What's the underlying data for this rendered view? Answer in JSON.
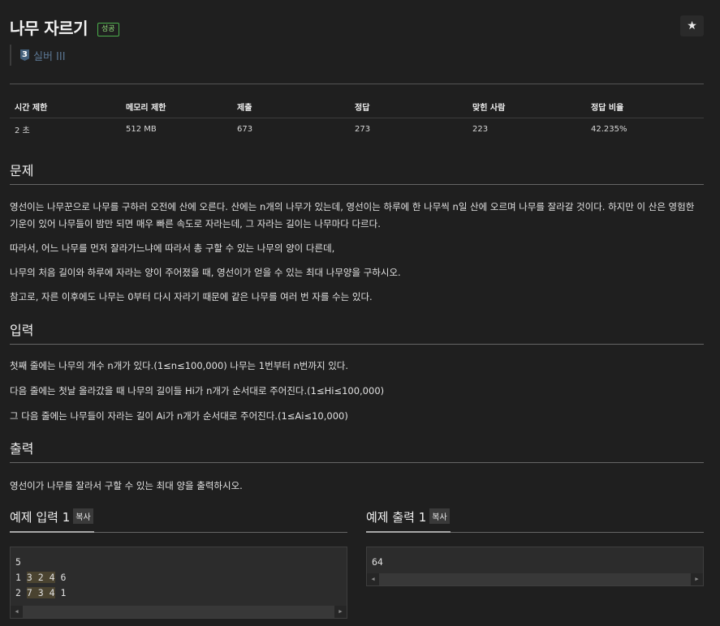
{
  "problem": {
    "title": "나무 자르기",
    "status_badge": "성공",
    "star_glyph": "★",
    "tier_number": "3",
    "tier_label": "실버 III"
  },
  "stats": {
    "headers": [
      "시간 제한",
      "메모리 제한",
      "제출",
      "정답",
      "맞힌 사람",
      "정답 비율"
    ],
    "values": [
      "2 초",
      "512 MB",
      "673",
      "273",
      "223",
      "42.235%"
    ]
  },
  "sections": {
    "problem_heading": "문제",
    "problem_paragraphs": [
      "영선이는 나무꾼으로 나무를 구하러 오전에 산에 오른다. 산에는 n개의 나무가 있는데, 영선이는 하루에 한 나무씩 n일 산에 오르며 나무를 잘라갈 것이다. 하지만 이 산은 영험한 기운이 있어 나무들이 밤만 되면 매우 빠른 속도로 자라는데, 그 자라는 길이는 나무마다 다르다.",
      "따라서, 어느 나무를 먼저 잘라가느냐에 따라서 총 구할 수 있는 나무의 양이 다른데,",
      "나무의 처음 길이와 하루에 자라는 양이 주어졌을 때, 영선이가 얻을 수 있는 최대 나무양을 구하시오.",
      "참고로, 자른 이후에도 나무는 0부터 다시 자라기 때문에 같은 나무를 여러 번 자를 수는 있다."
    ],
    "input_heading": "입력",
    "input_paragraphs": [
      "첫째 줄에는 나무의 개수 n개가 있다.(1≤n≤100,000) 나무는 1번부터 n번까지 있다.",
      "다음 줄에는 첫날 올라갔을 때 나무의 길이들 Hi가 n개가 순서대로 주어진다.(1≤Hi≤100,000)",
      "그 다음 줄에는 나무들이 자라는 길이 Ai가 n개가 순서대로 주어진다.(1≤Ai≤10,000)"
    ],
    "output_heading": "출력",
    "output_paragraphs": [
      "영선이가 나무를 잘라서 구할 수 있는 최대 양을 출력하시오."
    ]
  },
  "samples": {
    "input_title": "예제 입력 1",
    "output_title": "예제 출력 1",
    "copy_label": "복사",
    "input_lines": [
      [
        "5"
      ],
      [
        "1",
        "3",
        "2",
        "4",
        "6"
      ],
      [
        "2",
        "7",
        "3",
        "4",
        "1"
      ]
    ],
    "output_text": "64",
    "scroll_left": "◀",
    "scroll_right": "▶"
  }
}
